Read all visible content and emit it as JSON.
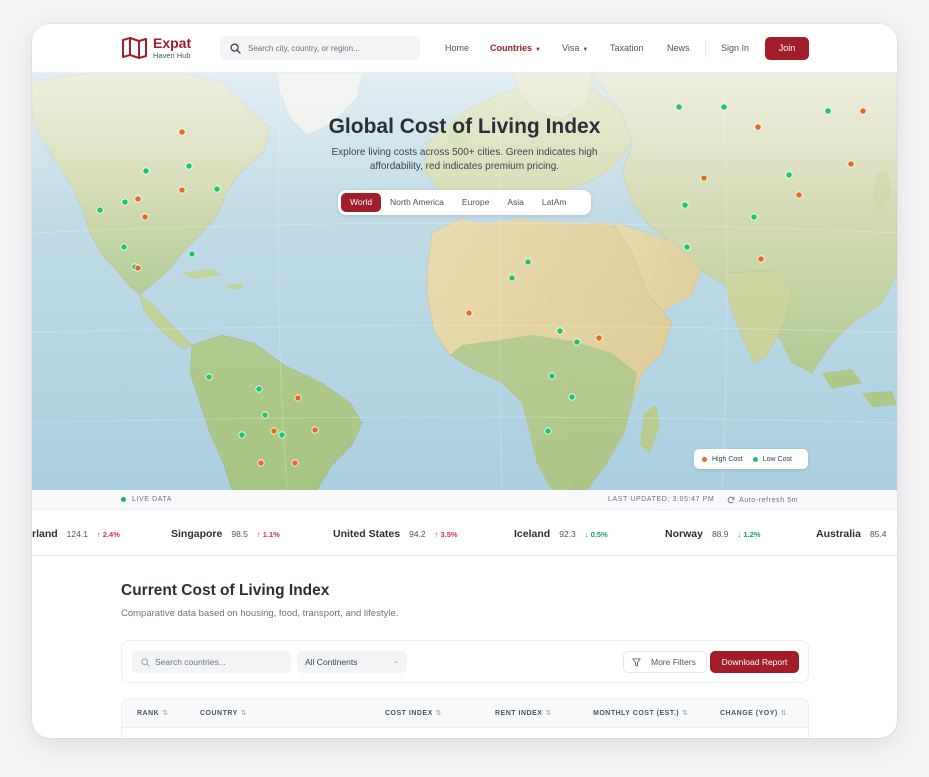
{
  "header": {
    "logo_title": "Expat",
    "logo_sub": "Haven Hub",
    "search_placeholder": "Search city, country, or region...",
    "nav": [
      {
        "label": "Home"
      },
      {
        "label": "Countries",
        "active": true,
        "dropdown": true
      },
      {
        "label": "Visa",
        "dropdown": true
      },
      {
        "label": "Taxation"
      },
      {
        "label": "News"
      }
    ],
    "sign_in": "Sign In",
    "join": "Join"
  },
  "hero": {
    "title": "Global Cost of Living Index",
    "subtitle_line1": "Explore living costs across 500+ cities. Green indicates high",
    "subtitle_line2": "affordability, red indicates premium pricing.",
    "region_tabs": [
      "World",
      "North America",
      "Europe",
      "Asia",
      "LatAm"
    ],
    "active_region": "World",
    "legend": {
      "high": "High Cost",
      "low": "Low Cost"
    }
  },
  "status": {
    "live": "LIVE DATA",
    "updated": "LAST UPDATED: 3:05:47 PM",
    "refresh": "Auto-refresh 5m"
  },
  "ticker": [
    {
      "name": "rland",
      "value": "124.1",
      "change": "2.4%",
      "dir": "up"
    },
    {
      "name": "Singapore",
      "value": "98.5",
      "change": "1.1%",
      "dir": "up"
    },
    {
      "name": "United States",
      "value": "94.2",
      "change": "3.5%",
      "dir": "up"
    },
    {
      "name": "Iceland",
      "value": "92.3",
      "change": "0.5%",
      "dir": "down"
    },
    {
      "name": "Norway",
      "value": "88.9",
      "change": "1.2%",
      "dir": "down"
    },
    {
      "name": "Australia",
      "value": "85.4",
      "change": "",
      "dir": "up"
    }
  ],
  "section": {
    "title": "Current Cost of Living Index",
    "subtitle": "Comparative data based on housing, food, transport, and lifestyle.",
    "search_placeholder": "Search countries...",
    "continent_select": "All Continents",
    "more_filters": "More Filters",
    "download": "Download Report"
  },
  "table": {
    "columns": [
      "RANK",
      "COUNTRY",
      "COST INDEX",
      "RENT INDEX",
      "MONTHLY COST (EST.)",
      "CHANGE (YOY)"
    ]
  },
  "colors": {
    "brand": "#a11d2a",
    "high_cost": "#e86a1f",
    "low_cost": "#1fc46e"
  }
}
